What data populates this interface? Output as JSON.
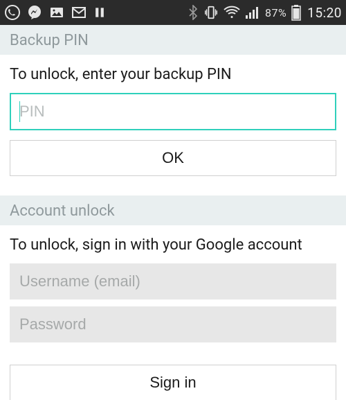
{
  "status_bar": {
    "battery_pct": "87%",
    "clock": "15:20"
  },
  "backup_pin": {
    "header": "Backup PIN",
    "instruction": "To unlock, enter your backup PIN",
    "pin_placeholder": "PIN",
    "pin_value": "",
    "ok_label": "OK"
  },
  "account_unlock": {
    "header": "Account unlock",
    "instruction": "To unlock, sign in with your Google account",
    "username_placeholder": "Username (email)",
    "username_value": "",
    "password_placeholder": "Password",
    "password_value": "",
    "signin_label": "Sign in"
  }
}
